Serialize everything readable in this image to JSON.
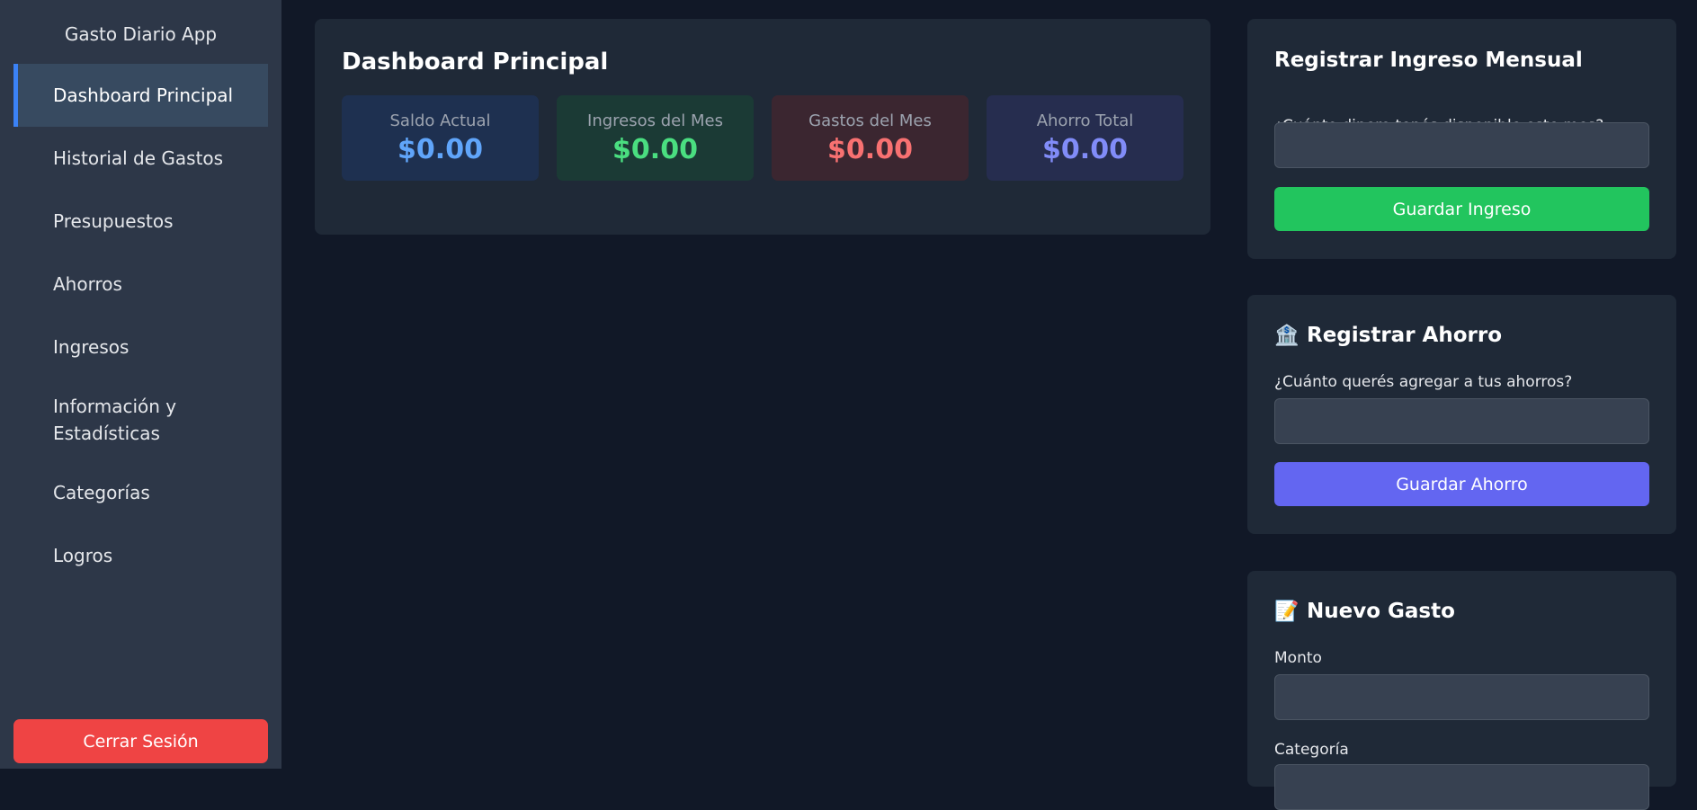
{
  "sidebar": {
    "app_title": "Gasto Diario App",
    "items": [
      {
        "label": "Dashboard Principal"
      },
      {
        "label": "Historial de Gastos"
      },
      {
        "label": "Presupuestos"
      },
      {
        "label": "Ahorros"
      },
      {
        "label": "Ingresos"
      },
      {
        "label": "Información y Estadísticas"
      },
      {
        "label": "Categorías"
      },
      {
        "label": "Logros"
      }
    ],
    "logout_label": "Cerrar Sesión"
  },
  "dashboard": {
    "title": "Dashboard Principal",
    "stats": [
      {
        "label": "Saldo Actual",
        "value": "$0.00",
        "color": "#60a5fa",
        "bg": "#1e3050"
      },
      {
        "label": "Ingresos del Mes",
        "value": "$0.00",
        "color": "#4ade80",
        "bg": "#1b3a35"
      },
      {
        "label": "Gastos del Mes",
        "value": "$0.00",
        "color": "#f87171",
        "bg": "#3b2630"
      },
      {
        "label": "Ahorro Total",
        "value": "$0.00",
        "color": "#818cf8",
        "bg": "#262d4f"
      }
    ]
  },
  "income_panel": {
    "title": "Registrar Ingreso Mensual",
    "question": "¿Cuánto dinero tenés disponible este mes?",
    "input_value": "",
    "button_label": "Guardar Ingreso",
    "button_color": "#22c55e"
  },
  "savings_panel": {
    "icon": "bank-icon",
    "icon_glyph": "🏦",
    "title": "Registrar Ahorro",
    "question": "¿Cuánto querés agregar a tus ahorros?",
    "input_value": "",
    "button_label": "Guardar Ahorro",
    "button_color": "#6366f1"
  },
  "expense_panel": {
    "icon": "memo-icon",
    "icon_glyph": "📝",
    "title": "Nuevo Gasto",
    "amount_label": "Monto",
    "amount_value": "",
    "category_label": "Categoría"
  },
  "colors": {
    "page_bg": "#111827",
    "sidebar_bg": "#2d3748",
    "card_bg": "#1f2937",
    "accent": "#3b82f6",
    "danger": "#ef4444"
  }
}
